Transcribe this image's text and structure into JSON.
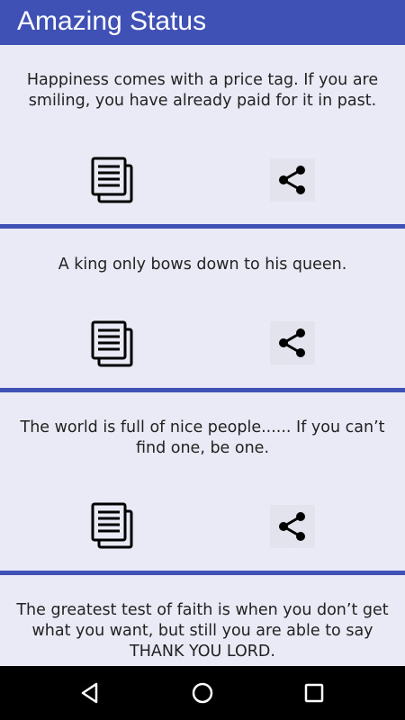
{
  "app_bar": {
    "title": "Amazing Status"
  },
  "statuses": [
    {
      "text": "Happiness comes with a price tag. If you are smiling, you have already paid for it in past."
    },
    {
      "text": "A king only bows down to his queen."
    },
    {
      "text": "The world is full of nice people...... If you can’t find one, be one."
    },
    {
      "text": "The greatest test of faith is when you don’t get what you want, but still you are able to say THANK YOU LORD."
    }
  ],
  "icons": {
    "copy": "copy-icon",
    "share": "share-icon",
    "back": "back-icon",
    "home": "home-icon",
    "recents": "recents-icon"
  },
  "colors": {
    "primary": "#3f51b5",
    "background": "#e9eaf6",
    "nav_bar": "#000000"
  }
}
